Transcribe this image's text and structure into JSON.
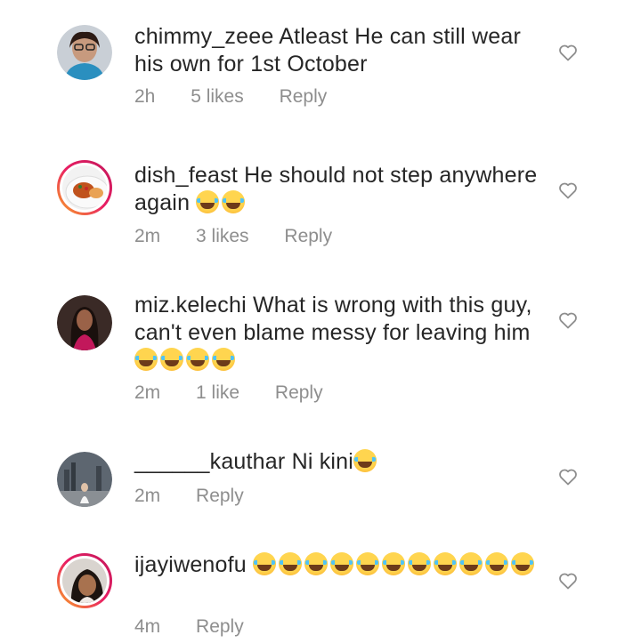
{
  "comments": [
    {
      "username": "chimmy_zeee",
      "text": "Atleast He can still wear his own for 1st October",
      "emoji_count": 0,
      "time": "2h",
      "likes": "5 likes",
      "reply": "Reply",
      "avatar_icon": "profile-photo-woman-glasses"
    },
    {
      "username": "dish_feast",
      "text": "He should not step anywhere again",
      "emoji_count": 2,
      "time": "2m",
      "likes": "3 likes",
      "reply": "Reply",
      "avatar_icon": "profile-photo-food-plate"
    },
    {
      "username": "miz.kelechi",
      "text": "What is wrong with this guy, can't even blame messy for leaving him",
      "emoji_count": 4,
      "time": "2m",
      "likes": "1 like",
      "reply": "Reply",
      "avatar_icon": "profile-photo-woman"
    },
    {
      "username": "______kauthar",
      "text": "Ni kini",
      "emoji_count": 1,
      "time": "2m",
      "likes": "",
      "reply": "Reply",
      "avatar_icon": "profile-photo-city-skyline"
    },
    {
      "username": "ijayiwenofu",
      "text": "",
      "emoji_count": 11,
      "time": "4m",
      "likes": "",
      "reply": "Reply",
      "avatar_icon": "profile-photo-woman-selfie"
    }
  ],
  "icons": {
    "like": "heart-outline-icon",
    "emoji": "face-with-tears-of-joy-emoji"
  },
  "colors": {
    "username": "#262626",
    "text": "#262626",
    "meta": "#8e8e8e",
    "story_ring_start": "#f9a825",
    "story_ring_end": "#c2185b"
  }
}
